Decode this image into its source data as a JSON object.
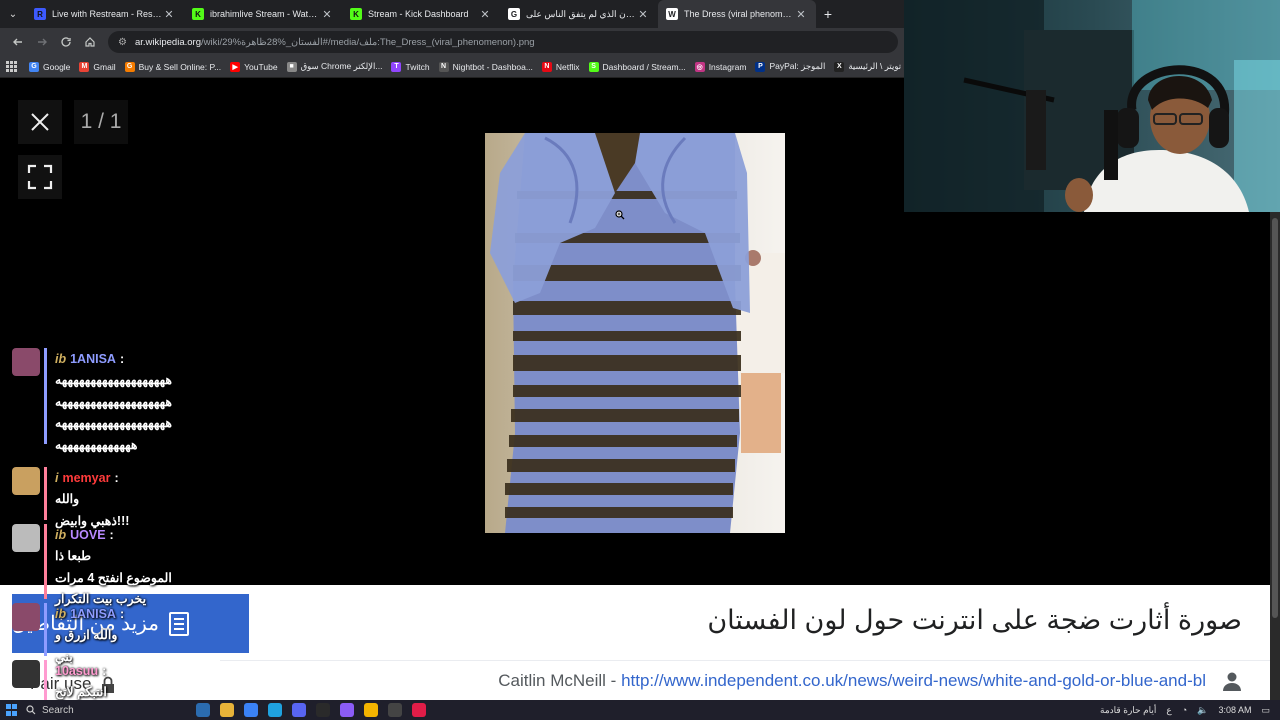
{
  "browser": {
    "tabs": [
      {
        "title": "Live with Restream - Restream",
        "favicon_color": "#3d5afe",
        "favicon": "R"
      },
      {
        "title": "ibrahimlive Stream - Watch Live",
        "favicon_color": "#53fc18",
        "favicon": "K"
      },
      {
        "title": "Stream - Kick Dashboard",
        "favicon_color": "#53fc18",
        "favicon": "K"
      },
      {
        "title": "الفستان الذي لم يتفق الناس على",
        "favicon_color": "#ffffff",
        "favicon": "G"
      },
      {
        "title": "The Dress (viral phenomenon)",
        "favicon_color": "#ffffff",
        "favicon": "W",
        "active": true
      }
    ],
    "address": {
      "host": "ar.wikipedia.org",
      "path": "/wiki/29%الفستان_%28ظاهرة#/media/ملف:The_Dress_(viral_phenomenon).png"
    },
    "bookmarks": [
      {
        "label": "Google",
        "color": "#4285f4",
        "ic": "G"
      },
      {
        "label": "Gmail",
        "color": "#ea4335",
        "ic": "M"
      },
      {
        "label": "Buy & Sell Online: P...",
        "color": "#f57c00",
        "ic": "G"
      },
      {
        "label": "YouTube",
        "color": "#ff0000",
        "ic": "▶"
      },
      {
        "label": "سوق Chrome الإلكتر...",
        "color": "#888888",
        "ic": "■"
      },
      {
        "label": "Twitch",
        "color": "#9146ff",
        "ic": "T"
      },
      {
        "label": "Nightbot - Dashboa...",
        "color": "#555555",
        "ic": "N"
      },
      {
        "label": "Netflix",
        "color": "#e50914",
        "ic": "N"
      },
      {
        "label": "Dashboard / Stream...",
        "color": "#53fc18",
        "ic": "S"
      },
      {
        "label": "Instagram",
        "color": "#c13584",
        "ic": "◎"
      },
      {
        "label": "PayPal: الموجز",
        "color": "#003087",
        "ic": "P"
      },
      {
        "label": "تويتر \\ الرئيسية",
        "color": "#222222",
        "ic": "X"
      }
    ]
  },
  "viewer": {
    "counter": "1 / 1",
    "caption": "صورة أثارت ضجة على انترنت حول لون الفستان",
    "author": "Caitlin McNeill",
    "separator": " - ",
    "link": "http://www.independent.co.uk/news/weird-news/white-and-gold-or-blue-and-bl",
    "more_details": "مزيد من التفاصيل",
    "fair_use": "Fair use"
  },
  "chat": [
    {
      "user": "1ANISA",
      "user_color": "#8e9cff",
      "badge": "ib",
      "avatar_color": "#8a4a6a",
      "bar_color": "#8e9cff",
      "lines": [
        "هههههههههههههههههههه",
        "هههههههههههههههههههه",
        "هههههههههههههههههههه",
        "هههههههههههههه"
      ]
    },
    {
      "user": "memyar",
      "user_color": "#ff3b3b",
      "badge": "i",
      "avatar_color": "#c9a060",
      "bar_color": "#ff7f9a",
      "lines": [
        "والله",
        "ذهبي وابيض!!!"
      ]
    },
    {
      "user": "UOVE",
      "user_color": "#b889ff",
      "badge": "ib",
      "avatar_color": "#bbbbbb",
      "bar_color": "#ff7f9a",
      "lines": [
        "طبعا ذا",
        "الموضوع انفتح 4 مرات",
        "يخرب بيت التكرار"
      ]
    },
    {
      "user": "1ANISA",
      "user_color": "#8e9cff",
      "badge": "ib",
      "avatar_color": "#8a4a6a",
      "bar_color": "#8e9cff",
      "lines": [
        "والله ازرق و",
        "بني"
      ]
    },
    {
      "user": "10asuu",
      "user_color": "#ff9bd0",
      "badge": "",
      "avatar_color": "#333333",
      "bar_color": "#ff9bd0",
      "lines": [
        "انتبكم لاتخ",
        "ترجعوا عليه"
      ]
    }
  ],
  "taskbar": {
    "search": "Search",
    "weather": "أيام حارة قادمة",
    "lang": "ع",
    "time": "3:08 AM"
  }
}
